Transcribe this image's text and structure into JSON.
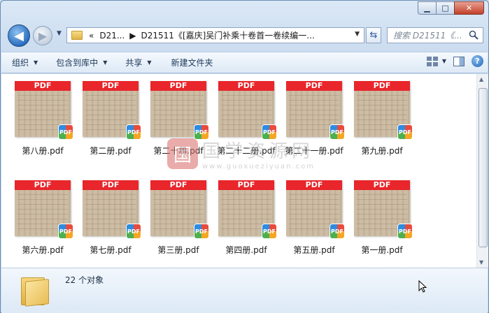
{
  "window": {
    "caption_buttons": {
      "minimize": "▁",
      "maximize": "□",
      "close": "✕"
    }
  },
  "nav": {
    "back_icon": "◀",
    "forward_icon": "▶",
    "breadcrumb": [
      "«",
      "D21...",
      "D21511《[嘉庆]吴门补乘十卷首一卷续编一..."
    ],
    "search_placeholder": "搜索 D21511《..."
  },
  "toolbar": {
    "organize": "组织",
    "include_in_library": "包含到库中",
    "share": "共享",
    "new_folder": "新建文件夹"
  },
  "files": [
    {
      "label": "第八册.pdf"
    },
    {
      "label": "第二册.pdf"
    },
    {
      "label": "第二十册.pdf"
    },
    {
      "label": "第二十二册.pdf"
    },
    {
      "label": "第二十一册.pdf"
    },
    {
      "label": "第九册.pdf"
    },
    {
      "label": "第六册.pdf"
    },
    {
      "label": "第七册.pdf"
    },
    {
      "label": "第三册.pdf"
    },
    {
      "label": "第四册.pdf"
    },
    {
      "label": "第五册.pdf"
    },
    {
      "label": "第一册.pdf"
    }
  ],
  "thumbnail": {
    "banner": "PDF",
    "badge": "PDF"
  },
  "watermark": {
    "logo": "国",
    "text": "国学资源网",
    "url": "www.guoxueziyuan.com"
  },
  "status": {
    "count": "22 个对象"
  }
}
